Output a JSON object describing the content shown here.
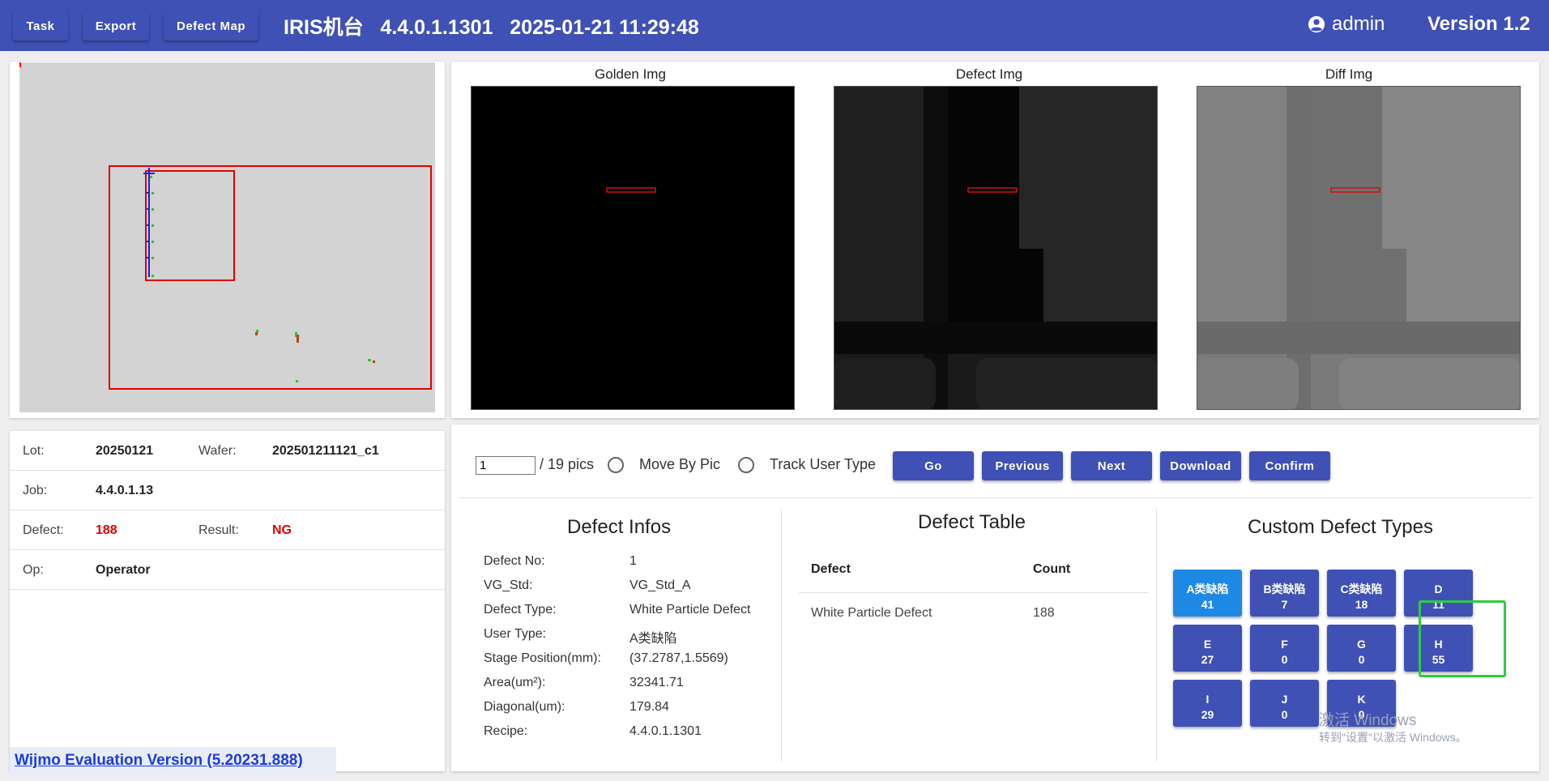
{
  "header": {
    "buttons": [
      "Task",
      "Export",
      "Defect Map"
    ],
    "title": "IRIS机台   4.4.0.1.1301   2025-01-21 11:29:48",
    "user": "admin",
    "version": "Version 1.2"
  },
  "images": {
    "golden_label": "Golden Img",
    "defect_label": "Defect Img",
    "diff_label": "Diff Img"
  },
  "info": {
    "lot_label": "Lot:",
    "lot": "20250121",
    "wafer_label": "Wafer:",
    "wafer": "202501211121_c1",
    "job_label": "Job:",
    "job": "4.4.0.1.13",
    "defect_label": "Defect:",
    "defect": "188",
    "result_label": "Result:",
    "result": "NG",
    "op_label": "Op:",
    "op": "Operator"
  },
  "wijmo_link": "Wijmo Evaluation Version (5.20231.888)",
  "toolbar": {
    "page_value": "1",
    "page_total": "/ 19 pics",
    "move_by_pic": "Move By Pic",
    "track_user_type": "Track User Type",
    "go": "Go",
    "previous": "Previous",
    "next": "Next",
    "download": "Download",
    "confirm": "Confirm"
  },
  "defect_infos": {
    "title": "Defect Infos",
    "rows": [
      {
        "label": "Defect No:",
        "value": "1"
      },
      {
        "label": "VG_Std:",
        "value": "VG_Std_A"
      },
      {
        "label": "Defect Type:",
        "value": "White Particle Defect"
      },
      {
        "label": "User Type:",
        "value": "A类缺陷"
      },
      {
        "label": "Stage Position(mm):",
        "value": "(37.2787,1.5569)"
      },
      {
        "label": "Area(um²):",
        "value": "32341.71"
      },
      {
        "label": "Diagonal(um):",
        "value": "179.84"
      },
      {
        "label": "Recipe:",
        "value": "4.4.0.1.1301"
      }
    ]
  },
  "defect_table": {
    "title": "Defect Table",
    "col_defect": "Defect",
    "col_count": "Count",
    "rows": [
      {
        "defect": "White Particle Defect",
        "count": "188"
      }
    ]
  },
  "custom_types": {
    "title": "Custom Defect Types",
    "items": [
      {
        "name": "A类缺陷",
        "count": "41"
      },
      {
        "name": "B类缺陷",
        "count": "7"
      },
      {
        "name": "C类缺陷",
        "count": "18"
      },
      {
        "name": "D",
        "count": "11"
      },
      {
        "name": "E",
        "count": "27"
      },
      {
        "name": "F",
        "count": "0"
      },
      {
        "name": "G",
        "count": "0"
      },
      {
        "name": "H",
        "count": "55"
      },
      {
        "name": "I",
        "count": "29"
      },
      {
        "name": "J",
        "count": "0"
      },
      {
        "name": "K",
        "count": "0"
      }
    ]
  },
  "watermark": {
    "line1": "激活 Windows",
    "line2": "转到\"设置\"以激活 Windows。"
  },
  "colors": {
    "primary": "#3f51b5",
    "active_type": "#1e88e5",
    "ng_red": "#e00000",
    "highlight": "#2ecc40"
  }
}
